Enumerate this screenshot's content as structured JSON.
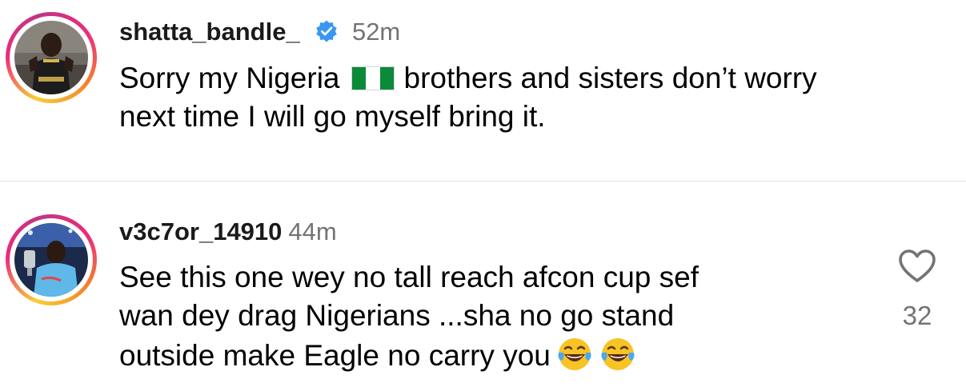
{
  "comments": [
    {
      "username": "shatta_bandle_",
      "verified": true,
      "timestamp": "52m",
      "text_part1": "Sorry my Nigeria",
      "flag_icon": "nigeria-flag-icon",
      "text_part2": "brothers and sisters don’t worry",
      "text_line2": "next time I will go myself bring it.",
      "avatar_ring_colors": [
        "#f9ce34",
        "#ee2a7b",
        "#c13584"
      ]
    },
    {
      "username": "v3c7or_14910",
      "verified": false,
      "timestamp": "44m",
      "text_lines": [
        "See this one wey no tall reach afcon cup sef",
        "wan dey drag Nigerians ...sha no go stand",
        "outside make Eagle no carry you"
      ],
      "emojis": [
        "face-with-tears-of-joy-icon",
        "face-with-tears-of-joy-icon"
      ],
      "like_count": "32",
      "avatar_ring_colors": [
        "#f9ce34",
        "#ee2a7b",
        "#c13584"
      ]
    }
  ],
  "colors": {
    "verified_badge": "#3897f0",
    "secondary_text": "#737373",
    "divider": "#e4e4e4"
  }
}
